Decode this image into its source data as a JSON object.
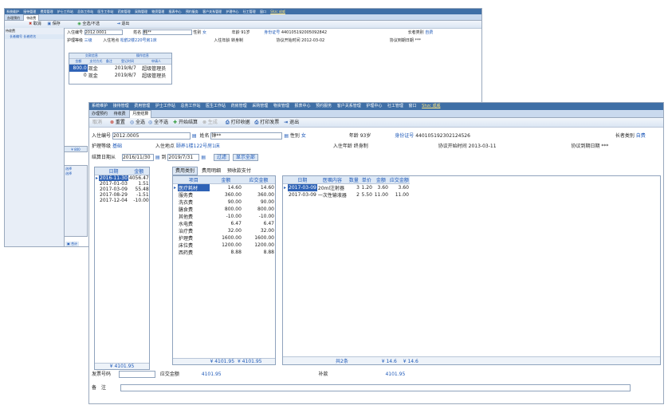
{
  "back": {
    "menu": [
      "系统维护",
      "接待管理",
      "费用管理",
      "护士工作站",
      "总务工作站",
      "医生工作站",
      "药房管理",
      "采购管理",
      "物资管理",
      "报表中心",
      "预约服务",
      "客户关系管理",
      "护理中心",
      "社工管理",
      "窗口"
    ],
    "menu_user": "Shzc 成威",
    "tabs": [
      "办理预约",
      "待收费"
    ],
    "toolbar": [
      "取消",
      "保存",
      "全选/不选",
      "退出"
    ],
    "left_label": "待收费",
    "left_cols": [
      "长者编号",
      "长者姓名"
    ],
    "form": {
      "admission_no_label": "入住编号",
      "admission_no": "2012.0001",
      "name_label": "姓名",
      "name": "韩**",
      "gender_label": "性别",
      "gender": "女",
      "age_label": "年龄",
      "age": "91岁",
      "id_label": "身份证号",
      "id_value": "440105192005092842",
      "category_label": "长者类别",
      "category": "自费",
      "care_label": "护理等级",
      "care": "三级",
      "location_label": "入住地点",
      "location": "松鹤2楼220号房1床",
      "age_group_label": "入住年龄",
      "age_group": "转身制",
      "start_label": "协议开始时间",
      "start": "2012-03-02",
      "end_label": "协议到期日期",
      "end": "***"
    },
    "pay_grid": {
      "group_headers": [
        "交款信息",
        "操作信息"
      ],
      "cols": [
        "金额",
        "支付方式",
        "备注",
        "登记时间",
        "申请人"
      ],
      "rows": [
        {
          "amount": "800.0",
          "method": "现金",
          "note": "",
          "date": "2019/8/7",
          "by": "超级管理员"
        },
        {
          "amount": "0",
          "method": "现金",
          "note": "",
          "date": "2019/8/7",
          "by": "超级管理员"
        }
      ]
    },
    "status": "合计"
  },
  "front": {
    "menu": [
      "系统维护",
      "接待管理",
      "费用管理",
      "护士工作站",
      "总务工作站",
      "医生工作站",
      "药房管理",
      "采购管理",
      "物资管理",
      "报表中心",
      "预约服务",
      "客户关系管理",
      "护理中心",
      "社工管理",
      "窗口"
    ],
    "menu_user": "Shzc 成威",
    "tabs": [
      "办理预约",
      "待收费",
      "月度结算"
    ],
    "toolbar": [
      "取消",
      "重置",
      "全选",
      "全不选",
      "开始结算",
      "生成",
      "打印收据",
      "打印发票",
      "退出"
    ],
    "form": {
      "admission_no_label": "入住编号",
      "admission_no": "2012.0005",
      "name_label": "姓名",
      "name": "钟**",
      "gender_label": "性别",
      "gender": "女",
      "age_label": "年龄",
      "age": "93岁",
      "id_label": "身份证号",
      "id_value": "440105192302124526",
      "category_label": "长者类别",
      "category": "自费",
      "care_label": "护理等级",
      "care": "基础",
      "location_label": "入住地点",
      "location": "颐养1楼122号房1床",
      "age_group_label": "入住年龄",
      "age_group": "终身制",
      "start_label": "协议开始时间",
      "start": "2013-03-11",
      "end_label": "协议到期日期",
      "end": "***"
    },
    "settle": {
      "from_label": "结算日期从",
      "from": "2016/11/30",
      "to_label": "到",
      "to": "2019/7/31",
      "filter_btn": "过滤",
      "show_all_btn": "显示全部"
    },
    "left_strip": {
      "total": "¥ 800",
      "label1": "选择",
      "label2": "选择"
    },
    "dates_grid": {
      "cols": [
        "日期",
        "金额"
      ],
      "rows": [
        {
          "date": "2016-11-30",
          "amount": "4056.47"
        },
        {
          "date": "2017-01-03",
          "amount": "1.51"
        },
        {
          "date": "2017-03-09",
          "amount": "55.48"
        },
        {
          "date": "2017-08-29",
          "amount": "-1.51"
        },
        {
          "date": "2017-12-04",
          "amount": "-10.00"
        }
      ],
      "footer": "¥ 4101.95"
    },
    "subtabs": [
      "费用类别",
      "费用明细",
      "预收款支付"
    ],
    "cat_grid": {
      "cols": [
        "项目",
        "金额",
        "应交金额"
      ],
      "rows": [
        {
          "item": "医疗耗材",
          "amount": "14.60",
          "due": "14.60"
        },
        {
          "item": "服务费",
          "amount": "360.00",
          "due": "360.00"
        },
        {
          "item": "洗衣费",
          "amount": "90.00",
          "due": "90.00"
        },
        {
          "item": "膳食费",
          "amount": "800.00",
          "due": "800.00"
        },
        {
          "item": "其他费",
          "amount": "-10.00",
          "due": "-10.00"
        },
        {
          "item": "水电费",
          "amount": "6.47",
          "due": "6.47"
        },
        {
          "item": "治疗费",
          "amount": "32.00",
          "due": "32.00"
        },
        {
          "item": "护理费",
          "amount": "1600.00",
          "due": "1600.00"
        },
        {
          "item": "床位费",
          "amount": "1200.00",
          "due": "1200.00"
        },
        {
          "item": "西药费",
          "amount": "8.88",
          "due": "8.88"
        }
      ],
      "footer1": "¥ 4101.95",
      "footer2": "¥ 4101.95"
    },
    "detail_grid": {
      "cols": [
        "日期",
        "医嘱内容",
        "数量",
        "单价",
        "金额",
        "应交金额"
      ],
      "rows": [
        {
          "date": "2017-03-09",
          "content": "20ml注射器",
          "qty": "3",
          "price": "1.20",
          "amount": "3.60",
          "due": "3.60"
        },
        {
          "date": "2017-03-09",
          "content": "一次性输液器",
          "qty": "2",
          "price": "5.50",
          "amount": "11.00",
          "due": "11.00"
        }
      ],
      "footer_count": "共2条",
      "footer1": "¥ 14.6",
      "footer2": "¥ 14.6"
    },
    "bottom": {
      "invoice_label": "发票号码",
      "due_label": "应交金额",
      "due": "4101.95",
      "supp_label": "补款",
      "supp": "4101.95",
      "remark_label": "备　注"
    }
  }
}
